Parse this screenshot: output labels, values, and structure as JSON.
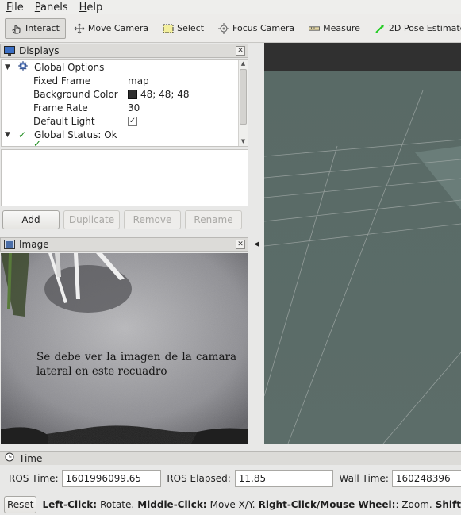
{
  "menu": [
    {
      "first": "F",
      "rest": "ile"
    },
    {
      "first": "P",
      "rest": "anels"
    },
    {
      "first": "H",
      "rest": "elp"
    }
  ],
  "toolbar": {
    "interact": "Interact",
    "move_camera": "Move Camera",
    "select": "Select",
    "focus_camera": "Focus Camera",
    "measure": "Measure",
    "pose_estimate": "2D Pose Estimate"
  },
  "displays": {
    "title": "Displays",
    "global_options": "Global Options",
    "fixed_frame_label": "Fixed Frame",
    "fixed_frame_value": "map",
    "bg_color_label": "Background Color",
    "bg_color_value": "48; 48; 48",
    "bg_color_swatch": "#303030",
    "frame_rate_label": "Frame Rate",
    "frame_rate_value": "30",
    "default_light_label": "Default Light",
    "default_light_checked": "✓",
    "global_status": "Global Status: Ok"
  },
  "buttons": {
    "add": "Add",
    "duplicate": "Duplicate",
    "remove": "Remove",
    "rename": "Rename"
  },
  "image_panel": {
    "title": "Image",
    "overlay_text": "Se debe ver la imagen de la camara lateral en este recuadro"
  },
  "time": {
    "title": "Time",
    "ros_time_label": "ROS Time:",
    "ros_time_value": "1601996099.65",
    "ros_elapsed_label": "ROS Elapsed:",
    "ros_elapsed_value": "11.85",
    "wall_time_label": "Wall Time:",
    "wall_time_value": "160248396"
  },
  "status": {
    "reset": "Reset",
    "left_click_label": "Left-Click:",
    "left_click_text": "Rotate.",
    "middle_click_label": "Middle-Click:",
    "middle_click_text": "Move X/Y.",
    "right_click_label": "Right-Click/Mouse Wheel:",
    "right_click_text": ": Zoom.",
    "shift_label": "Shift"
  },
  "colors": {
    "view_background": "#303030",
    "grid_line": "#a0a0a0",
    "pose_arrow": "#22cc22",
    "status_ok": "#1a8a1a"
  }
}
